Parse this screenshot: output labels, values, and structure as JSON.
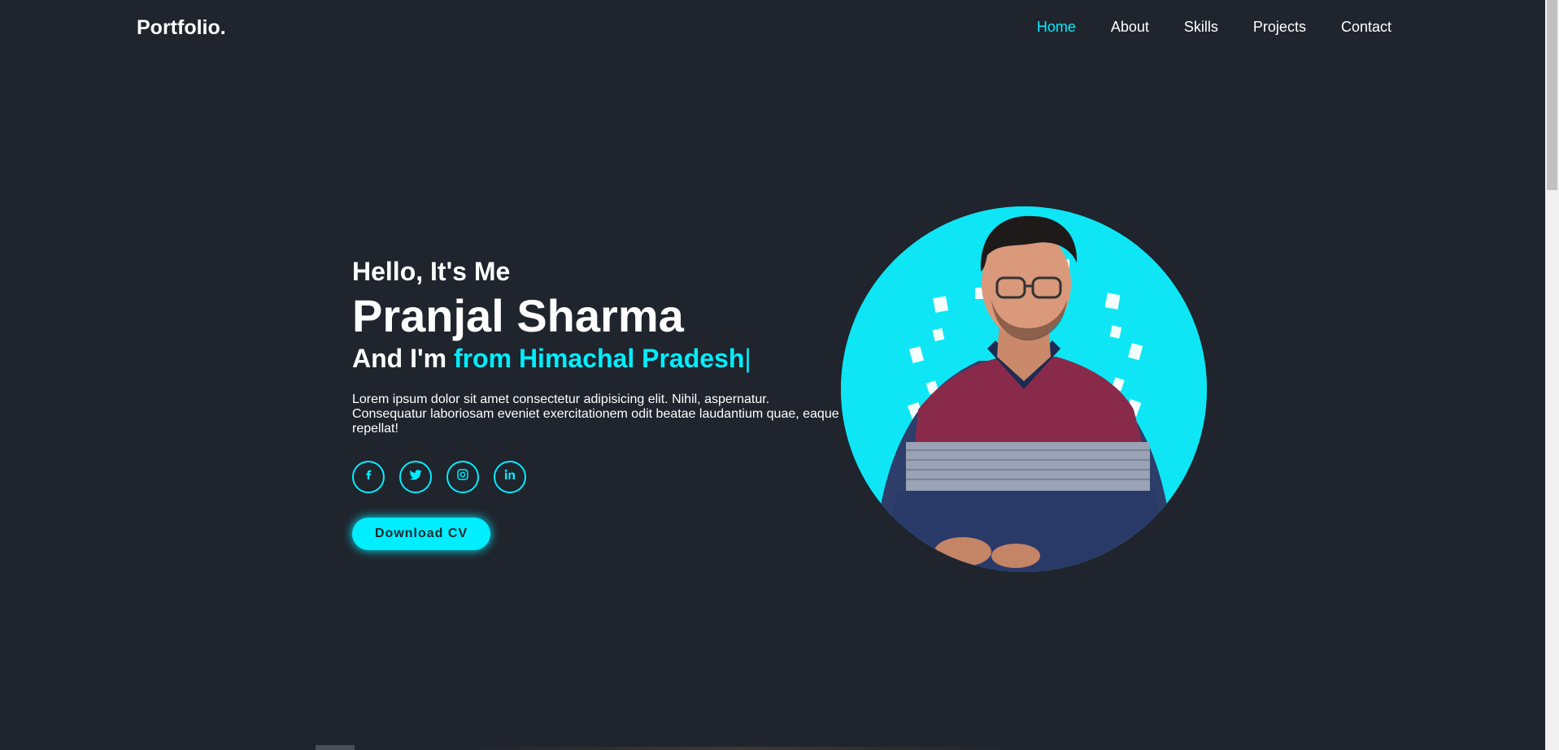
{
  "header": {
    "logo": "Portfolio.",
    "nav": [
      {
        "label": "Home",
        "active": true
      },
      {
        "label": "About",
        "active": false
      },
      {
        "label": "Skills",
        "active": false
      },
      {
        "label": "Projects",
        "active": false
      },
      {
        "label": "Contact",
        "active": false
      }
    ]
  },
  "home": {
    "greeting": "Hello, It's Me",
    "name": "Pranjal Sharma",
    "intro_prefix": "And I'm ",
    "typed_text": "from Himachal Pradesh",
    "caret": "|",
    "description": "Lorem ipsum dolor sit amet consectetur adipisicing elit. Nihil, aspernatur. Consequatur laboriosam eveniet exercitationem odit beatae laudantium quae, eaque repellat!",
    "socials": [
      {
        "icon": "facebook-icon"
      },
      {
        "icon": "twitter-icon"
      },
      {
        "icon": "instagram-icon"
      },
      {
        "icon": "linkedin-icon"
      }
    ],
    "button_label": "Download CV"
  },
  "colors": {
    "background": "#1f242d",
    "accent": "#00eeff",
    "text": "#ffffff"
  }
}
